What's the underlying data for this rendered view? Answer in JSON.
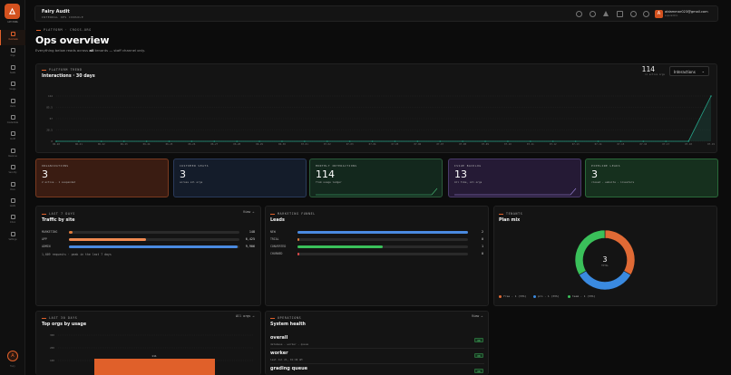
{
  "sidebar": {
    "brand_sub": "CATCHING",
    "items": [
      {
        "label": "Overview",
        "active": true
      },
      {
        "label": "Orgs"
      },
      {
        "label": "Seats"
      },
      {
        "label": "Usage"
      },
      {
        "label": "Users"
      },
      {
        "label": "Credentials"
      },
      {
        "label": "Audit"
      },
      {
        "label": "Revenue"
      },
      {
        "label": "Security"
      },
      {
        "label": "Docs"
      },
      {
        "label": "Leads"
      },
      {
        "label": "Inbox"
      },
      {
        "label": "Settings"
      }
    ],
    "avatar": "A",
    "footer": "Fairy"
  },
  "topbar": {
    "title": "Fairy Audit",
    "subtitle": "INTERNAL OPS CONSOLE",
    "avatar_letter": "A",
    "email": "aldammar023@gmail.com",
    "role": "superadmin"
  },
  "breadcrumb": "PLATFORM · CROSS-ORG",
  "page": {
    "title": "Ops overview",
    "subtitle_pre": "Everything below reads across ",
    "subtitle_bold": "all",
    "subtitle_post": " tenants — staff channel only."
  },
  "trend": {
    "label": "PLATFORM TREND",
    "title": "Interactions · 30 days",
    "total": "114",
    "total_sub": "in active orgs",
    "selector": "Interactions"
  },
  "chart_data": {
    "type": "area",
    "x": [
      "06-20",
      "06-21",
      "06-22",
      "06-23",
      "06-24",
      "06-25",
      "06-26",
      "06-27",
      "06-28",
      "06-29",
      "06-30",
      "07-01",
      "07-02",
      "07-03",
      "07-04",
      "07-05",
      "07-06",
      "07-07",
      "07-08",
      "07-09",
      "07-10",
      "07-11",
      "07-12",
      "07-13",
      "07-14",
      "07-15",
      "07-16",
      "07-17",
      "07-18",
      "07-19"
    ],
    "values": [
      0,
      0,
      0,
      0,
      0,
      0,
      0,
      0,
      0,
      0,
      0,
      0,
      0,
      0,
      0,
      0,
      0,
      0,
      0,
      0,
      0,
      0,
      0,
      0,
      0,
      0,
      0,
      0,
      0,
      114
    ],
    "y_ticks": [
      "114",
      "85.5",
      "57",
      "28.5",
      "0"
    ],
    "ylim": [
      0,
      114
    ],
    "grid": true,
    "color": "#26a58a"
  },
  "stats": [
    {
      "label": "ORGANIZATIONS",
      "value": "3",
      "desc": "2 active · 1 suspended",
      "bg": "#3a1c12",
      "border": "#7a3a20"
    },
    {
      "label": "CUSTOMER SEATS",
      "value": "3",
      "desc": "across all orgs",
      "bg": "#141c2a",
      "border": "#2a3a5a"
    },
    {
      "label": "MONTHLY INTERACTIONS",
      "value": "114",
      "desc": "from usage ledger",
      "bg": "#13281d",
      "border": "#2a5a3a"
    },
    {
      "label": "ISSUE BACKLOG",
      "value": "13",
      "desc": "All time, all orgs",
      "bg": "#251a35",
      "border": "#4a3a6a"
    },
    {
      "label": "PIPELINE LEADS",
      "value": "3",
      "desc": "closed · website · investors",
      "bg": "#16301e",
      "border": "#2a6a3a"
    }
  ],
  "traffic": {
    "label": "LAST 7 DAYS",
    "title": "Traffic by site",
    "link": "View →",
    "rows": [
      {
        "name": "MARKETING",
        "value": "148",
        "pct": 0.02,
        "color": "#e07a3a"
      },
      {
        "name": "APP",
        "value": "6,425",
        "pct": 0.45,
        "color": "#f08a50"
      },
      {
        "name": "ADMIN",
        "value": "9,906",
        "pct": 0.99,
        "color": "#4a8ae0"
      }
    ],
    "footer": "1,009 requests · peak in the last 7 days"
  },
  "funnel": {
    "label": "MARKETING FUNNEL",
    "title": "Leads",
    "rows": [
      {
        "name": "NEW",
        "value": "2",
        "pct": 1.0,
        "color": "#4a8ae0"
      },
      {
        "name": "TRIAL",
        "value": "0",
        "pct": 0.0,
        "color": "#e07a3a"
      },
      {
        "name": "CONVERTED",
        "value": "1",
        "pct": 0.5,
        "color": "#3ac05a"
      },
      {
        "name": "CHURNED",
        "value": "0",
        "pct": 0.0,
        "color": "#e04a4a"
      }
    ]
  },
  "plan": {
    "label": "TENANTS",
    "title": "Plan mix",
    "center_value": "3",
    "center_sub": "TOTAL",
    "slices": [
      {
        "name": "free",
        "value": 1,
        "color": "#e06a35"
      },
      {
        "name": "pro",
        "value": 1,
        "color": "#3a8ae0"
      },
      {
        "name": "team",
        "value": 1,
        "color": "#3ac05a"
      }
    ],
    "legend": [
      {
        "text": "free · 1 (33%)",
        "color": "#e06a35"
      },
      {
        "text": "pro · 1 (33%)",
        "color": "#3a8ae0"
      },
      {
        "text": "team · 1 (33%)",
        "color": "#3ac05a"
      }
    ]
  },
  "orgs": {
    "label": "LAST 30 DAYS",
    "title": "Top orgs by usage",
    "link": "All orgs →",
    "y_ticks": [
      "300",
      "200",
      "100"
    ],
    "bar_label": "111"
  },
  "health": {
    "label": "OPERATIONS",
    "title": "System health",
    "link": "View →",
    "rows": [
      {
        "name": "overall",
        "detail": "database · worker · queue",
        "badge": "OK"
      },
      {
        "name": "worker",
        "detail": "last Jul 21, 01:49 AM",
        "badge": "OK"
      },
      {
        "name": "grading queue",
        "detail": "",
        "badge": "OK"
      }
    ]
  }
}
